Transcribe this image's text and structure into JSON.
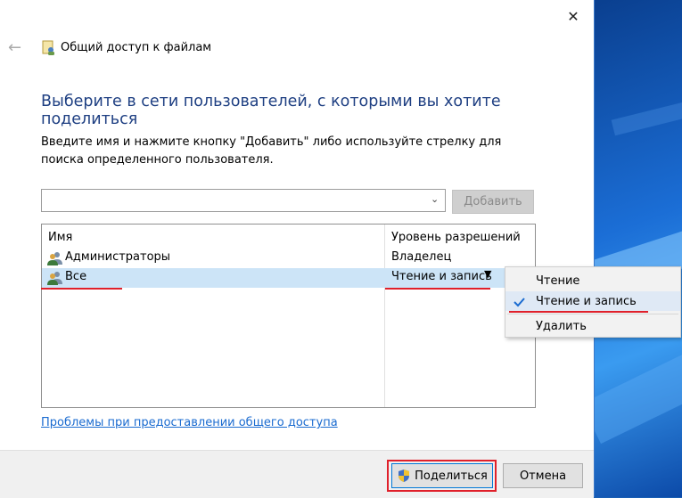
{
  "window": {
    "title": "Общий доступ к файлам",
    "close_glyph": "✕",
    "back_glyph": "←"
  },
  "main": {
    "heading": "Выберите в сети пользователей, с которыми вы хотите поделиться",
    "instruction": "Введите имя и нажмите кнопку \"Добавить\" либо используйте стрелку для поиска определенного пользователя.",
    "name_input": {
      "value": "",
      "arrow_glyph": "⌄"
    },
    "add_button": "Добавить"
  },
  "users_table": {
    "columns": [
      "Имя",
      "Уровень разрешений"
    ],
    "rows": [
      {
        "name": "Администраторы",
        "permission": "Владелец",
        "icon": "users-icon"
      },
      {
        "name": "Все",
        "permission": "Чтение и запись",
        "icon": "users-icon",
        "selected": true
      }
    ],
    "perm_arrow_glyph": "▼"
  },
  "context_menu": {
    "items": [
      {
        "label": "Чтение",
        "checked": false
      },
      {
        "label": "Чтение и запись",
        "checked": true
      },
      {
        "label": "Удалить",
        "checked": false
      }
    ]
  },
  "help_link": "Проблемы при предоставлении общего доступа",
  "footer": {
    "share_button": "Поделиться",
    "cancel_button": "Отмена"
  },
  "colors": {
    "heading": "#1e3f82",
    "link": "#1a6bd0",
    "selection": "#cce4f7",
    "annotation_red": "#e0202a"
  }
}
